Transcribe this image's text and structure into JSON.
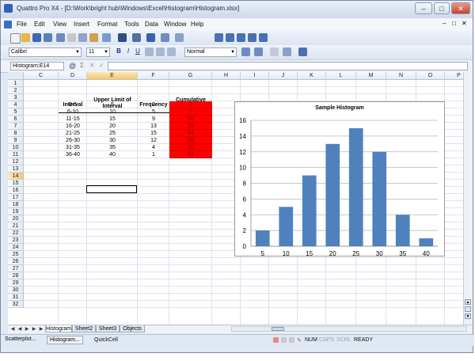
{
  "window": {
    "title": "Quattro Pro X4 - [D:\\Work\\bright hub\\Windows\\Excel\\Histogram\\Histogram.xlsx]"
  },
  "menu": [
    "File",
    "Edit",
    "View",
    "Insert",
    "Format",
    "Tools",
    "Data",
    "Window",
    "Help"
  ],
  "format": {
    "font": "Calibri",
    "size": "11",
    "style": "Normal",
    "bold": "B",
    "italic": "I",
    "underline": "U"
  },
  "input_line": {
    "cell_ref": "Histogram:E14",
    "at_symbol": "@"
  },
  "columns": [
    "C",
    "D",
    "E",
    "F",
    "G",
    "H",
    "I",
    "J",
    "K",
    "L",
    "M",
    "N",
    "O",
    "P"
  ],
  "rows": [
    "1",
    "2",
    "3",
    "4",
    "5",
    "6",
    "7",
    "8",
    "9",
    "10",
    "11",
    "12",
    "13",
    "14",
    "15",
    "16",
    "17",
    "18",
    "19",
    "20",
    "21",
    "22",
    "23",
    "24",
    "25",
    "26",
    "27",
    "28",
    "29",
    "30",
    "31",
    "32"
  ],
  "table": {
    "headers": {
      "interval": "Interval",
      "upper_limit": "Upper Limit of Interval",
      "frequency": "Frequency",
      "cumulative": "Cumulative Frequency"
    },
    "rows": [
      {
        "interval": "0-5",
        "upper": "5",
        "freq": "2",
        "cum": "2"
      },
      {
        "interval": "6-10",
        "upper": "10",
        "freq": "5",
        "cum": "7"
      },
      {
        "interval": "11-15",
        "upper": "15",
        "freq": "9",
        "cum": "16"
      },
      {
        "interval": "16-20",
        "upper": "20",
        "freq": "13",
        "cum": "29"
      },
      {
        "interval": "21-25",
        "upper": "25",
        "freq": "15",
        "cum": "44"
      },
      {
        "interval": "26-30",
        "upper": "30",
        "freq": "12",
        "cum": "56"
      },
      {
        "interval": "31-35",
        "upper": "35",
        "freq": "4",
        "cum": "60"
      },
      {
        "interval": "36-40",
        "upper": "40",
        "freq": "1",
        "cum": "61"
      }
    ]
  },
  "sheet_tabs": [
    "Histogram",
    "Sheet2",
    "Sheet3",
    "Objects"
  ],
  "status": {
    "left_button": "Scatterplot...",
    "active_button": "Histogram...",
    "quickcell": "QuickCell",
    "num": "NUM",
    "caps": "CAPS",
    "scrl": "SCRL",
    "ready": "READY"
  },
  "colors": {
    "bar": "#4f81bd",
    "cumulative_fill": "#ff0000"
  },
  "chart_data": {
    "type": "bar",
    "title": "Sample Histogram",
    "categories": [
      "5",
      "10",
      "15",
      "20",
      "25",
      "30",
      "35",
      "40"
    ],
    "values": [
      2,
      5,
      9,
      13,
      15,
      12,
      4,
      1
    ],
    "ylim": [
      0,
      16
    ],
    "yticks": [
      0,
      2,
      4,
      6,
      8,
      10,
      12,
      14,
      16
    ],
    "grid": true,
    "xlabel": "",
    "ylabel": ""
  }
}
